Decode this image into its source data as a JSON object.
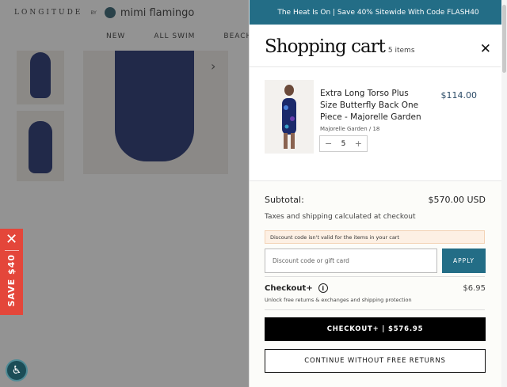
{
  "site": {
    "logo_brand": "LONGITUDE",
    "logo_by": "BY",
    "logo_partner": "mimi flamingo",
    "nav": [
      "NEW",
      "ALL SWIM",
      "BEACHWEAR"
    ]
  },
  "save_tab": {
    "close": "✕",
    "label": "SAVE $40"
  },
  "cart": {
    "promo_banner": "The Heat Is On | Save 40% Sitewide With Code FLASH40",
    "title": "Shopping cart",
    "item_count": "5 items",
    "close": "✕",
    "items": [
      {
        "title": "Extra Long Torso Plus Size Butterfly Back One Piece - Majorelle Garden",
        "price": "$114.00",
        "variant": "Majorelle Garden / 18",
        "qty_minus": "−",
        "quantity": "5",
        "qty_plus": "+"
      }
    ],
    "subtotal_label": "Subtotal:",
    "subtotal_value": "$570.00 USD",
    "tax_note": "Taxes and shipping calculated at checkout",
    "discount_notice": "Discount code isn't valid for the items in your cart",
    "discount_placeholder": "Discount code or gift card",
    "apply_label": "APPLY",
    "checkout_plus_label": "Checkout+",
    "checkout_plus_info": "i",
    "checkout_plus_price": "$6.95",
    "checkout_plus_desc": "Unlock free returns & exchanges and shipping protection",
    "checkout_button": "CHECKOUT+ | $576.95",
    "continue_button": "CONTINUE WITHOUT FREE RETURNS"
  },
  "colors": {
    "accent": "#236d86",
    "save_tab": "#e4463a",
    "swimsuit": "#1b2a6b"
  }
}
